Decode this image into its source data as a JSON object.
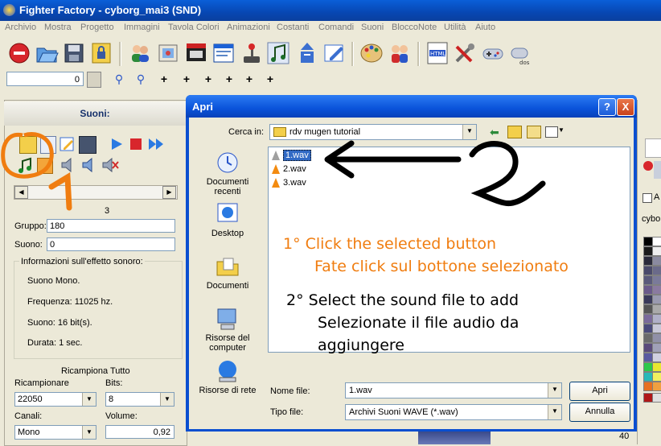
{
  "window": {
    "title": "Fighter Factory - cyborg_mai3 (SND)"
  },
  "menu": [
    "Archivio",
    "Mostra",
    "Progetto",
    "Immagini",
    "Tavola Colori",
    "Animazioni",
    "Costanti",
    "Comandi",
    "Suoni",
    "BloccoNote",
    "Utilità",
    "Aiuto"
  ],
  "toolbar": {
    "icons": [
      "stop-icon",
      "open-folder-icon",
      "save-disk-icon",
      "lock-icon",
      "people-icon",
      "picture-icon",
      "film-icon",
      "window-icon",
      "joystick-icon",
      "music-icon",
      "arrows-icon",
      "edit-icon",
      "html-icon",
      "tools-icon",
      "gamepad-icon",
      "palette-icon",
      "players-icon",
      "dos-icon"
    ],
    "number_value": "0"
  },
  "sounds_panel": {
    "header": "Suoni:",
    "index_display": "3",
    "group_label": "Gruppo:",
    "group_value": "180",
    "sound_label": "Suono:",
    "sound_value": "0",
    "info_title": "Informazioni sull'effetto sonoro:",
    "info_mono": "Suono Mono.",
    "info_freq": "Frequenza: 11025 hz.",
    "info_bits": "Suono: 16 bit(s).",
    "info_duration": "Durata: 1 sec.",
    "resample_title": "Ricampiona Tutto",
    "resample_label": "Ricampionare",
    "resample_value": "22050",
    "bits_label": "Bits:",
    "bits_value": "8",
    "channels_label": "Canali:",
    "channels_value": "Mono",
    "volume_label": "Volume:",
    "volume_value": "0,92"
  },
  "right_strip": {
    "checkbox_label": "A",
    "name": "cybo",
    "number": "40"
  },
  "dialog": {
    "title": "Apri",
    "look_in_label": "Cerca in:",
    "look_in_value": "rdv mugen tutorial",
    "places": [
      "Documenti recenti",
      "Desktop",
      "Documenti",
      "Risorse del computer",
      "Risorse di rete"
    ],
    "files": [
      "1.wav",
      "2.wav",
      "3.wav"
    ],
    "selected_file": "1.wav",
    "filename_label": "Nome file:",
    "filename_value": "1.wav",
    "filetype_label": "Tipo file:",
    "filetype_value": "Archivi Suoni WAVE (*.wav)",
    "open_button": "Apri",
    "cancel_button": "Annulla",
    "help_button": "?",
    "close_button": "X"
  },
  "annotations": {
    "step1_number": "1",
    "step2_number": "2",
    "step1_en": "1° Click the selected button",
    "step1_it": "Fate click sul bottone selezionato",
    "step2_en": "2° Select the sound file to add",
    "step2_it_line1": "Selezionate il file audio da",
    "step2_it_line2": "aggiungere"
  },
  "colors": {
    "annotation_orange": "#f07d10",
    "xp_blue": "#0a53da",
    "selection": "#316ac5"
  }
}
